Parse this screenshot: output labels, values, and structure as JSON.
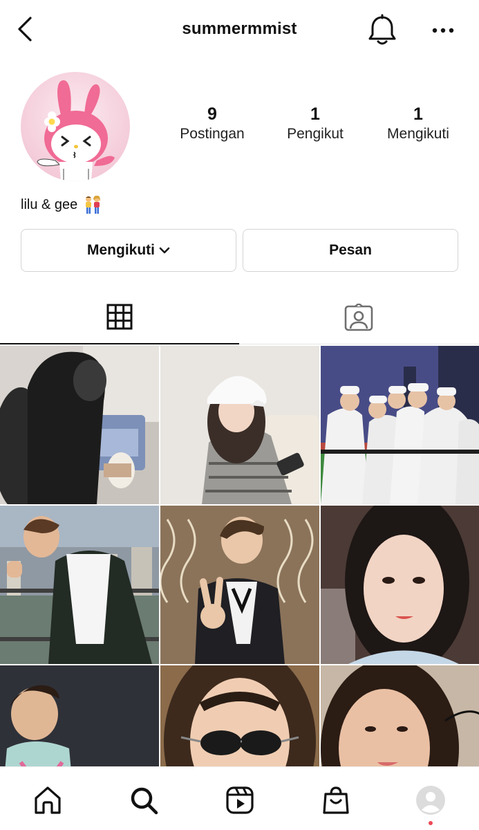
{
  "header": {
    "username": "summermmist",
    "icons": {
      "back": "chevron-left-icon",
      "bell": "bell-icon",
      "more": "more-horizontal-icon"
    }
  },
  "profile": {
    "avatar": "my-melody-avatar",
    "bio": "lilu & gee",
    "bio_emoji": "couple-emoji",
    "stats": [
      {
        "value": "9",
        "label": "Postingan"
      },
      {
        "value": "1",
        "label": "Pengikut"
      },
      {
        "value": "1",
        "label": "Mengikuti"
      }
    ]
  },
  "actions": {
    "follow_label": "Mengikuti",
    "message_label": "Pesan"
  },
  "tabs": [
    {
      "name": "grid",
      "icon": "grid-icon",
      "active": true
    },
    {
      "name": "tagged",
      "icon": "tagged-person-icon",
      "active": false
    }
  ],
  "posts": [
    {
      "id": 1,
      "caption": ""
    },
    {
      "id": 2,
      "caption": ""
    },
    {
      "id": 3,
      "caption": ""
    },
    {
      "id": 4,
      "caption": ""
    },
    {
      "id": 5,
      "caption": ""
    },
    {
      "id": 6,
      "caption": ""
    },
    {
      "id": 7,
      "caption": ""
    },
    {
      "id": 8,
      "caption": ""
    },
    {
      "id": 9,
      "caption": ""
    }
  ],
  "bottom_nav": [
    {
      "name": "home",
      "icon": "home-icon"
    },
    {
      "name": "search",
      "icon": "search-icon",
      "active": true
    },
    {
      "name": "reels",
      "icon": "reels-icon"
    },
    {
      "name": "shop",
      "icon": "shopping-bag-icon"
    },
    {
      "name": "profile",
      "icon": "profile-avatar-icon"
    }
  ],
  "colors": {
    "text": "#111111",
    "border": "#d4d4d4",
    "notification_dot": "#ed4956",
    "avatar_bg": "#f7dbe3",
    "melody_pink": "#f06b95"
  }
}
